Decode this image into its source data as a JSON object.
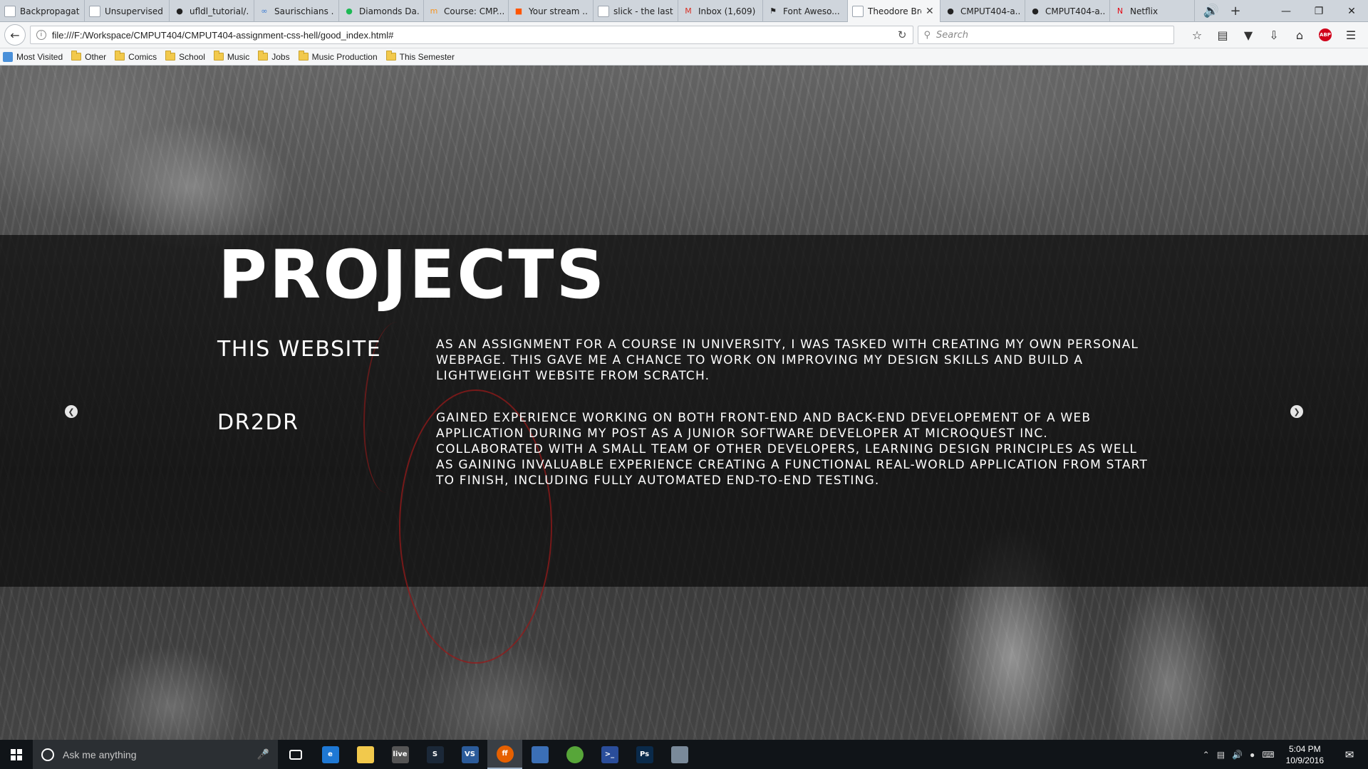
{
  "browser": {
    "tabs": [
      {
        "title": "Backpropagation ...",
        "icon": "page-icon",
        "color": "#9aa3ad"
      },
      {
        "title": "Unsupervised Fea...",
        "icon": "page-icon",
        "color": "#9aa3ad"
      },
      {
        "title": "ufldl_tutorial/...",
        "icon": "github-icon",
        "color": "#222222"
      },
      {
        "title": "Saurischians ...",
        "icon": "link-icon",
        "color": "#3b7bd4"
      },
      {
        "title": "Diamonds Da...",
        "icon": "spotify-icon",
        "color": "#1db954"
      },
      {
        "title": "Course: CMP...",
        "icon": "moodle-icon",
        "color": "#f7931e"
      },
      {
        "title": "Your stream ...",
        "icon": "soundcloud-icon",
        "color": "#ff5500"
      },
      {
        "title": "slick - the last car...",
        "icon": "page-icon",
        "color": "#9aa3ad"
      },
      {
        "title": "Inbox (1,609) ...",
        "icon": "gmail-icon",
        "color": "#d93025"
      },
      {
        "title": "Font Aweso...",
        "icon": "fontawesome-icon",
        "color": "#222222"
      },
      {
        "title": "Theodore Bro...",
        "icon": "page-icon",
        "color": "#9aa3ad",
        "active": true
      },
      {
        "title": "CMPUT404-a...",
        "icon": "github-icon",
        "color": "#222222"
      },
      {
        "title": "CMPUT404-a...",
        "icon": "github-icon",
        "color": "#222222"
      },
      {
        "title": "Netflix",
        "icon": "netflix-icon",
        "color": "#e50914"
      }
    ],
    "url": "file:///F:/Workspace/CMPUT404/CMPUT404-assignment-css-hell/good_index.html#",
    "search_placeholder": "Search",
    "bookmarks": [
      {
        "label": "Most Visited",
        "icon": "most-visited-icon"
      },
      {
        "label": "Other",
        "icon": "folder-icon"
      },
      {
        "label": "Comics",
        "icon": "folder-icon"
      },
      {
        "label": "School",
        "icon": "folder-icon"
      },
      {
        "label": "Music",
        "icon": "folder-icon"
      },
      {
        "label": "Jobs",
        "icon": "folder-icon"
      },
      {
        "label": "Music Production",
        "icon": "folder-icon"
      },
      {
        "label": "This Semester",
        "icon": "folder-icon"
      }
    ]
  },
  "page": {
    "heading": "PROJECTS",
    "projects": [
      {
        "name": "THIS WEBSITE",
        "description": "As an assignment for a course in university, I was tasked with creating my own personal webpage. This gave me a chance to work on improving my design skills and build a lightweight website from scratch."
      },
      {
        "name": "DR2DR",
        "description": "Gained experience working on both front-end and back-end developement of a web application during my post as a Junior Software Developer at MicroQuest Inc. Collaborated with a small team of other developers, learning design principles as well as gaining invaluable experience creating a functional real-world application from start to finish, including fully automated end-to-end testing."
      }
    ],
    "carousel_prev_icon": "chevron-left-icon",
    "carousel_next_icon": "chevron-right-icon",
    "accent_color": "#961919"
  },
  "taskbar": {
    "search_placeholder": "Ask me anything",
    "apps": [
      {
        "name": "task-view",
        "label": "",
        "color": "#101418"
      },
      {
        "name": "edge",
        "label": "e",
        "color": "#1e78d4"
      },
      {
        "name": "file-explorer",
        "label": "",
        "color": "#f2c94c"
      },
      {
        "name": "livesplit",
        "label": "live",
        "color": "#555555"
      },
      {
        "name": "steam",
        "label": "S",
        "color": "#1b2838"
      },
      {
        "name": "visual-studio",
        "label": "VS",
        "color": "#2b5b9a"
      },
      {
        "name": "firefox",
        "label": "ff",
        "color": "#e66000",
        "active": true
      },
      {
        "name": "network-tool",
        "label": "",
        "color": "#3b6fb6"
      },
      {
        "name": "utorrent",
        "label": "",
        "color": "#57a639"
      },
      {
        "name": "powershell",
        "label": ">_",
        "color": "#2a4d9a"
      },
      {
        "name": "photoshop",
        "label": "Ps",
        "color": "#0a2a4a"
      },
      {
        "name": "paint-tool",
        "label": "",
        "color": "#7a8a9a"
      }
    ],
    "time": "5:04 PM",
    "date": "10/9/2016"
  }
}
